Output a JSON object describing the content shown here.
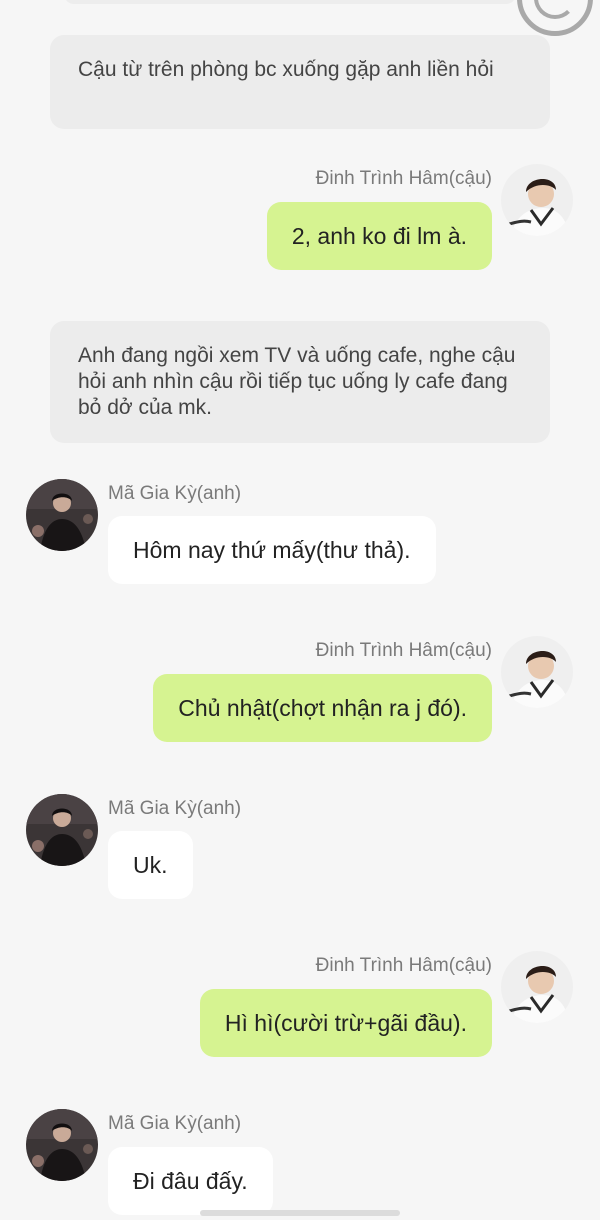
{
  "messages": [
    {
      "type": "narration",
      "text": "Cậu từ trên phòng bc xuống gặp anh liền hỏi"
    },
    {
      "type": "right",
      "sender": "Đinh Trình Hâm(cậu)",
      "text": "2, anh ko đi lm à.",
      "avatar": "avatar-dinh-trinh-ham"
    },
    {
      "type": "narration",
      "text": "Anh đang ngồi xem TV và uống cafe, nghe cậu hỏi anh nhìn cậu rồi tiếp tục uống ly cafe đang bỏ dở của mk."
    },
    {
      "type": "left",
      "sender": "Mã Gia Kỳ(anh)",
      "text": "Hôm nay thứ mấy(thư thả).",
      "avatar": "avatar-ma-gia-ky"
    },
    {
      "type": "right",
      "sender": "Đinh Trình Hâm(cậu)",
      "text": "Chủ nhật(chợt nhận ra j đó).",
      "avatar": "avatar-dinh-trinh-ham"
    },
    {
      "type": "left",
      "sender": "Mã Gia Kỳ(anh)",
      "text": "Uk.",
      "avatar": "avatar-ma-gia-ky"
    },
    {
      "type": "right",
      "sender": "Đinh Trình Hâm(cậu)",
      "text": "Hì hì(cười trừ+gãi đầu).",
      "avatar": "avatar-dinh-trinh-ham"
    },
    {
      "type": "left",
      "sender": "Mã Gia Kỳ(anh)",
      "text": "Đi đâu đấy.",
      "avatar": "avatar-ma-gia-ky"
    }
  ],
  "colors": {
    "background": "#f6f6f6",
    "narration_bg": "#ececec",
    "my_bubble": "#d6f391",
    "other_bubble": "#ffffff",
    "name_text": "#7a7a7a"
  }
}
